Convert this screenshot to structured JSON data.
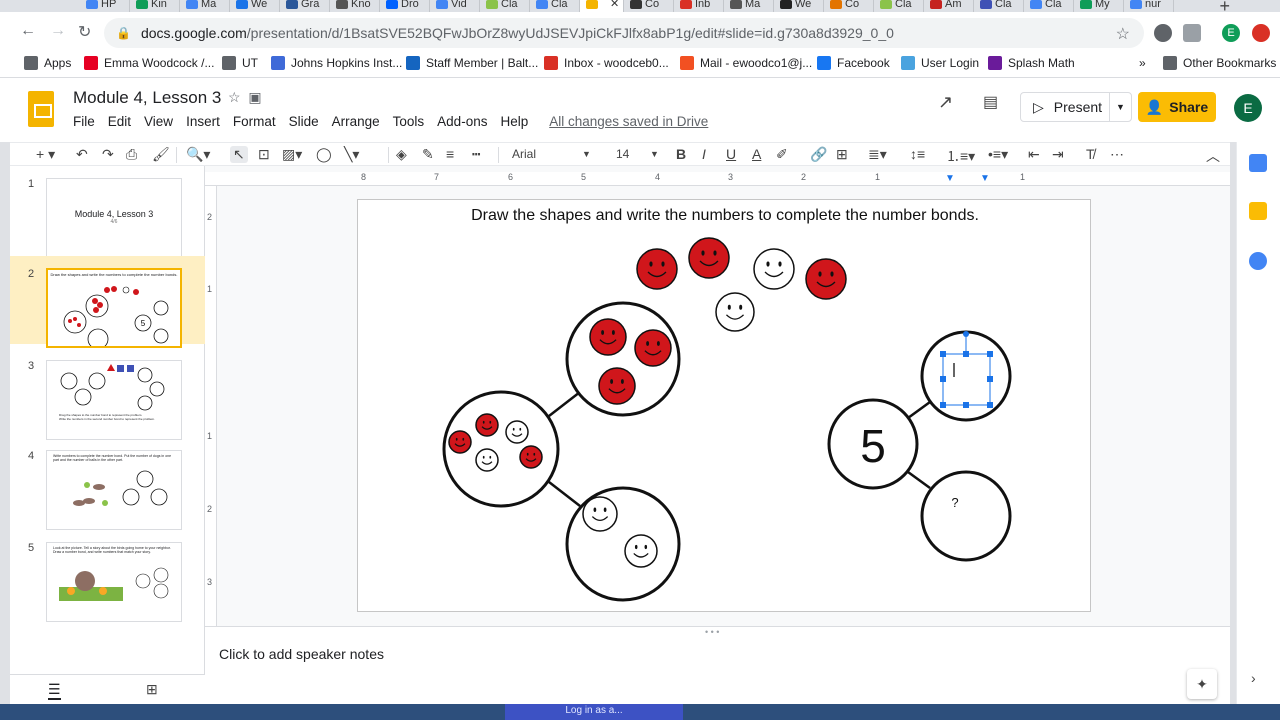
{
  "browser": {
    "tabs": [
      {
        "label": "HP",
        "color": "#4285f4"
      },
      {
        "label": "Kin",
        "color": "#0f9d58"
      },
      {
        "label": "Ma",
        "color": "#4285f4"
      },
      {
        "label": "We",
        "color": "#1a73e8"
      },
      {
        "label": "Gra",
        "color": "#2b579a"
      },
      {
        "label": "Kno",
        "color": "#555"
      },
      {
        "label": "Dro",
        "color": "#0061ff"
      },
      {
        "label": "Vid",
        "color": "#4285f4"
      },
      {
        "label": "Cla",
        "color": "#8bc34a"
      },
      {
        "label": "Cla",
        "color": "#4285f4"
      },
      {
        "label": "",
        "color": "#f4b400",
        "active": true,
        "close": "✕"
      },
      {
        "label": "Co",
        "color": "#333"
      },
      {
        "label": "Inb",
        "color": "#d93025"
      },
      {
        "label": "Ma",
        "color": "#555"
      },
      {
        "label": "We",
        "color": "#222"
      },
      {
        "label": "Co",
        "color": "#e37400"
      },
      {
        "label": "Cla",
        "color": "#8bc34a"
      },
      {
        "label": "Am",
        "color": "#c5221f"
      },
      {
        "label": "Cla",
        "color": "#3f51b5"
      },
      {
        "label": "Cla",
        "color": "#4285f4"
      },
      {
        "label": "My",
        "color": "#0f9d58"
      },
      {
        "label": "nur",
        "color": "#4285f4"
      }
    ],
    "new_tab": "+",
    "url_domain": "docs.google.com",
    "url_path": "/presentation/d/1BsatSVE52BQFwJbOrZ8wyUdJSEVJpiCkFJlfx8abP1g/edit#slide=id.g730a8d3929_0_0",
    "bookmarks": [
      {
        "label": "Apps",
        "color": "#5f6368"
      },
      {
        "label": "Emma Woodcock /...",
        "color": "#e60023"
      },
      {
        "label": "UT",
        "color": "#5f6368"
      },
      {
        "label": "Johns Hopkins Inst...",
        "color": "#3f6ad8"
      },
      {
        "label": "Staff Member | Balt...",
        "color": "#1565c0"
      },
      {
        "label": "Inbox - woodceb0...",
        "color": "#d93025"
      },
      {
        "label": "Mail - ewoodco1@j...",
        "color": "#f25022"
      },
      {
        "label": "Facebook",
        "color": "#1877f2"
      },
      {
        "label": "User Login",
        "color": "#4aa3df"
      },
      {
        "label": "Splash Math",
        "color": "#6a1b9a"
      }
    ],
    "bookmarks_more": "»",
    "other_bookmarks": "Other Bookmarks",
    "profile_initial": "E"
  },
  "doc": {
    "title": "Module 4, Lesson 3",
    "menu": [
      "File",
      "Edit",
      "View",
      "Insert",
      "Format",
      "Slide",
      "Arrange",
      "Tools",
      "Add-ons",
      "Help"
    ],
    "saved_status": "All changes saved in Drive",
    "present_label": "Present",
    "share_label": "Share",
    "avatar_initial": "E",
    "font_name": "Arial",
    "font_size": "14"
  },
  "ruler": {
    "top": [
      "8",
      "7",
      "6",
      "5",
      "4",
      "3",
      "2",
      "1",
      "1"
    ],
    "left": [
      "2",
      "1",
      "1",
      "2",
      "3"
    ]
  },
  "filmstrip": [
    {
      "num": "1",
      "title": "Module 4, Lesson 3",
      "sub": "4/6"
    },
    {
      "num": "2",
      "title": "Draw the shapes and write the numbers to complete the number bonds.",
      "selected": true,
      "bond_value": "5"
    },
    {
      "num": "3",
      "title": "Drag the shapes to the number bond to represent the problem.",
      "sub": "Write the numbers in the second number bond to represent the problem."
    },
    {
      "num": "4",
      "title": "Write numbers to complete the number bond. Put the number of dogs in one part and the number of balls in the other part."
    },
    {
      "num": "5",
      "title": "Look at the picture. Tell a story about the birds going home to your neighbor. Draw a number bond, and write numbers that match your story."
    }
  ],
  "slide": {
    "heading": "Draw the shapes and write the numbers to complete the number bonds.",
    "whole_value": "5",
    "unknown_value": "?",
    "red_fill": "#d0161b",
    "outline": "#111111"
  },
  "notes": {
    "placeholder": "Click to add speaker notes"
  },
  "taskbar": {
    "login_label": "Log in as a..."
  }
}
